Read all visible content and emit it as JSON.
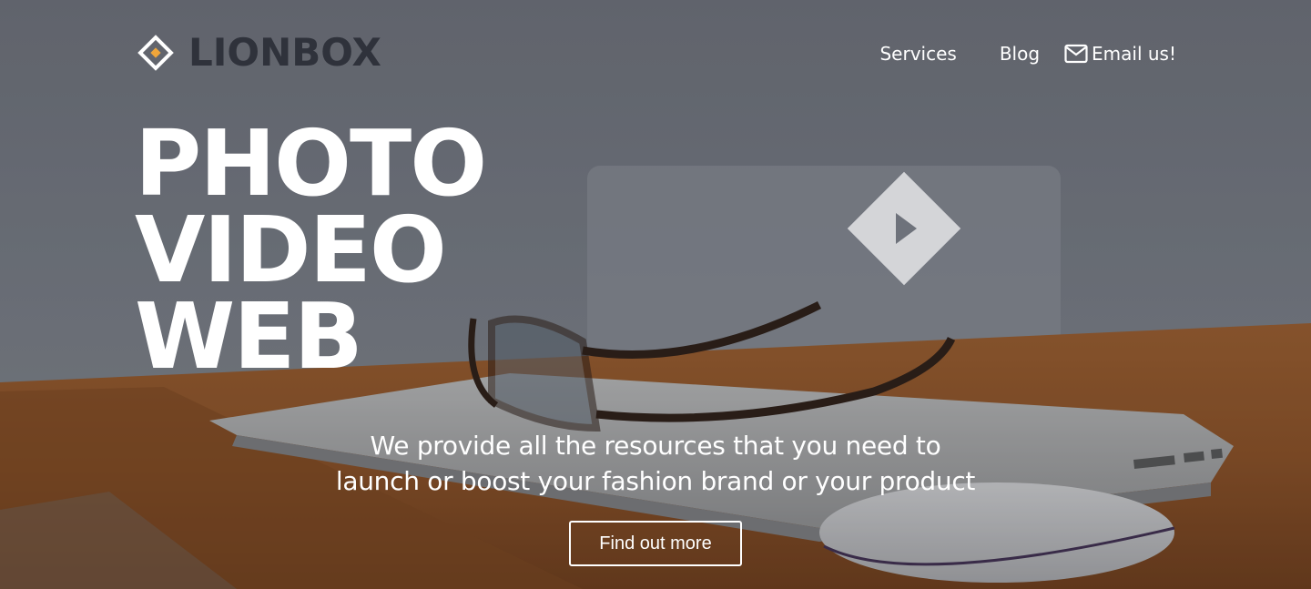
{
  "brand": {
    "name": "LIONBOX",
    "icon": "diamond-logo-icon",
    "text_color": "#2f323b",
    "accent_color": "#f0a63a"
  },
  "nav": {
    "items": [
      {
        "label": "Services"
      },
      {
        "label": "Blog"
      },
      {
        "label": "Email us!",
        "icon": "envelope-icon"
      }
    ]
  },
  "hero": {
    "headline": [
      "PHOTO",
      "VIDEO",
      "WEB"
    ],
    "play_icon": "play-icon",
    "tagline": [
      "We provide all the resources that you need to",
      "launch or boost your fashion brand or your product"
    ],
    "cta_label": "Find out more"
  }
}
